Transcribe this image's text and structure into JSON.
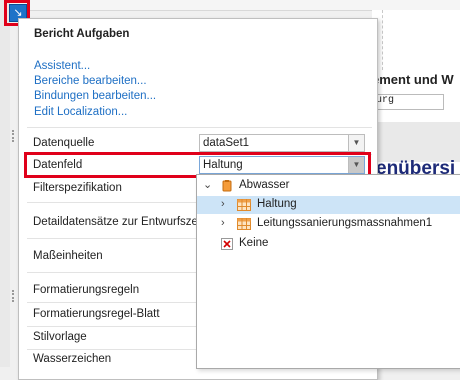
{
  "background": {
    "heading_fragment": "ement und W",
    "field_fragment": "urg",
    "title_fragment": "enübersi"
  },
  "panel": {
    "title": "Bericht Aufgaben",
    "links": [
      "Assistent...",
      "Bereiche bearbeiten...",
      "Bindungen bearbeiten...",
      "Edit Localization..."
    ],
    "properties": [
      {
        "label": "Datenquelle",
        "value": "dataSet1"
      },
      {
        "label": "Datenfeld",
        "value": "Haltung"
      },
      {
        "label": "Filterspezifikation"
      },
      {
        "label": "Detaildatensätze zur Entwurfszeit"
      },
      {
        "label": "Maßeinheiten"
      },
      {
        "label": "Formatierungsregeln"
      },
      {
        "label": "Formatierungsregel-Blatt"
      },
      {
        "label": "Stilvorlage"
      },
      {
        "label": "Wasserzeichen"
      }
    ]
  },
  "dropdown": {
    "items": [
      {
        "label": "Abwasser",
        "icon": "datasource-icon",
        "expanded": true
      },
      {
        "label": "Haltung",
        "icon": "table-icon",
        "selected": true
      },
      {
        "label": "Leitungssanierungsmassnahmen1",
        "icon": "table-icon"
      },
      {
        "label": "Keine",
        "icon": "none-icon"
      }
    ]
  },
  "colors": {
    "highlight": "#e0001a",
    "link": "#1e6fc4",
    "selection": "#cde4f7"
  }
}
